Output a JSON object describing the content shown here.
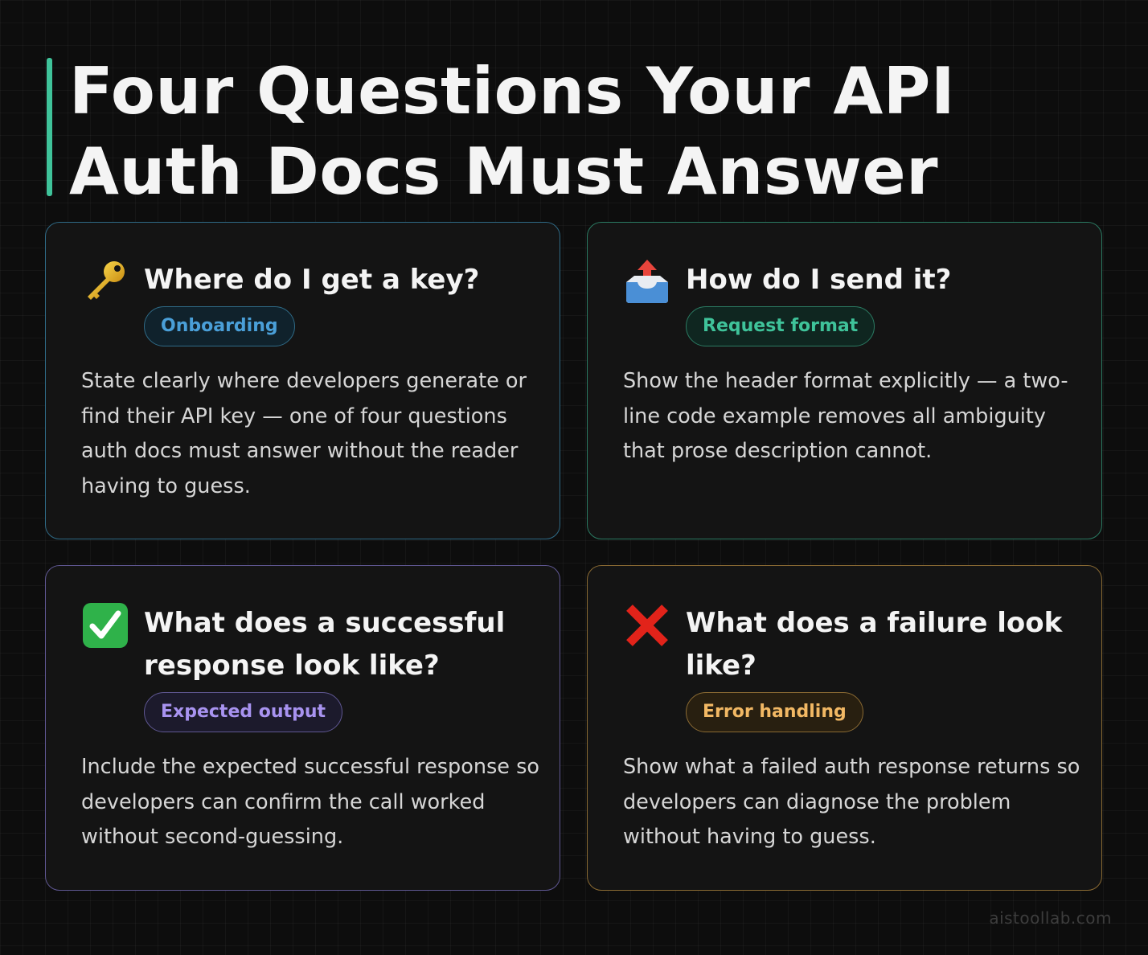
{
  "title": "Four Questions Your API Auth Docs Must Answer",
  "colors": {
    "accent_bar": "#3fc39a",
    "blue": "#4a9fd8",
    "green": "#3fc39a",
    "purple": "#a893f0",
    "amber": "#f2b864"
  },
  "cards": [
    {
      "icon": "key-icon",
      "question": "Where do I get a key?",
      "tag": "Onboarding",
      "body": "State clearly where developers generate or find their API key — one of four questions auth docs must answer without the reader having to guess."
    },
    {
      "icon": "outbox-tray-icon",
      "question": "How do I send it?",
      "tag": "Request format",
      "body": "Show the header format explicitly — a two-line code example removes all ambiguity that prose description cannot."
    },
    {
      "icon": "check-mark-icon",
      "question": "What does a successful response look like?",
      "tag": "Expected output",
      "body": "Include the expected successful response so developers can confirm the call worked without second-guessing."
    },
    {
      "icon": "cross-mark-icon",
      "question": "What does a failure look like?",
      "tag": "Error handling",
      "body": "Show what a failed auth response returns so developers can diagnose the problem without having to guess."
    }
  ],
  "footer": "aistoollab.com"
}
